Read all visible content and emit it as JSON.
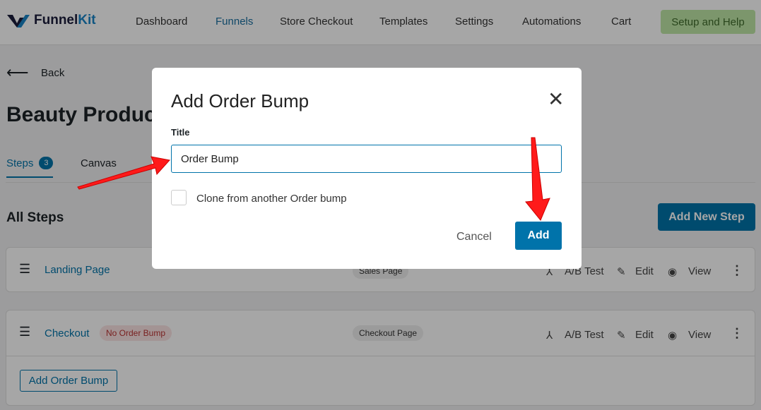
{
  "header": {
    "logo": "FunnelKit",
    "logo_accent": "Kit",
    "logo_main": "Funnel",
    "nav": [
      "Dashboard",
      "Funnels",
      "Store Checkout",
      "Templates",
      "Settings",
      "Automations",
      "Cart"
    ],
    "active_nav": "Funnels",
    "setup": "Setup and Help"
  },
  "page": {
    "back": "Back",
    "title": "Beauty Products",
    "tabs": [
      {
        "label": "Steps",
        "count": "3"
      },
      {
        "label": "Canvas"
      }
    ],
    "all_steps": "All Steps",
    "add_new_step": "Add New Step"
  },
  "steps": [
    {
      "name": "Landing Page",
      "type": "Sales Page",
      "ab": "A/B Test",
      "edit": "Edit",
      "view": "View"
    },
    {
      "name": "Checkout",
      "badge": "No Order Bump",
      "type": "Checkout Page",
      "ab": "A/B Test",
      "edit": "Edit",
      "view": "View",
      "add_bump": "Add Order Bump"
    }
  ],
  "modal": {
    "title": "Add Order Bump",
    "field_label": "Title",
    "field_value": "Order Bump",
    "clone_label": "Clone from another Order bump",
    "cancel": "Cancel",
    "add": "Add"
  },
  "colors": {
    "primary": "#0073aa",
    "annotation": "#ff0000"
  }
}
